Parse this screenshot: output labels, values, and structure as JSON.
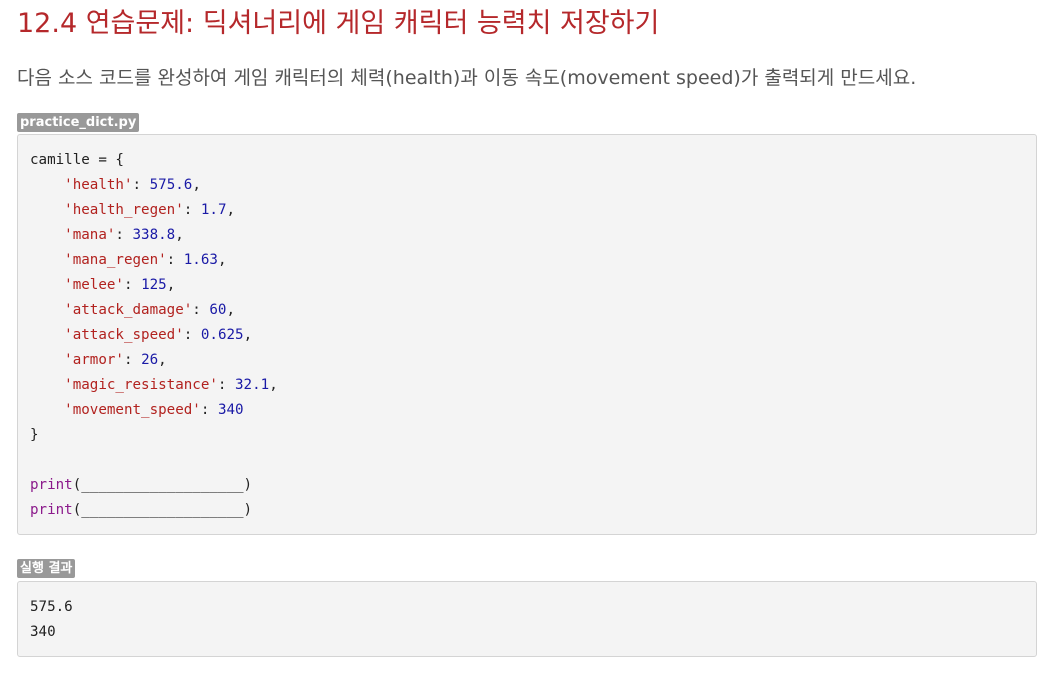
{
  "page": {
    "title": "12.4 연습문제: 딕셔너리에 게임 캐릭터 능력치 저장하기",
    "intro": "다음 소스 코드를 완성하여 게임 캐릭터의 체력(health)과 이동 속도(movement speed)가 출력되게 만드세요."
  },
  "source": {
    "filename": "practice_dict.py",
    "lines": [
      [
        {
          "t": "camille = {",
          "k": "plain"
        }
      ],
      [
        {
          "t": "    ",
          "k": "plain"
        },
        {
          "t": "'health'",
          "k": "str"
        },
        {
          "t": ": ",
          "k": "plain"
        },
        {
          "t": "575.6",
          "k": "num"
        },
        {
          "t": ",",
          "k": "plain"
        }
      ],
      [
        {
          "t": "    ",
          "k": "plain"
        },
        {
          "t": "'health_regen'",
          "k": "str"
        },
        {
          "t": ": ",
          "k": "plain"
        },
        {
          "t": "1.7",
          "k": "num"
        },
        {
          "t": ",",
          "k": "plain"
        }
      ],
      [
        {
          "t": "    ",
          "k": "plain"
        },
        {
          "t": "'mana'",
          "k": "str"
        },
        {
          "t": ": ",
          "k": "plain"
        },
        {
          "t": "338.8",
          "k": "num"
        },
        {
          "t": ",",
          "k": "plain"
        }
      ],
      [
        {
          "t": "    ",
          "k": "plain"
        },
        {
          "t": "'mana_regen'",
          "k": "str"
        },
        {
          "t": ": ",
          "k": "plain"
        },
        {
          "t": "1.63",
          "k": "num"
        },
        {
          "t": ",",
          "k": "plain"
        }
      ],
      [
        {
          "t": "    ",
          "k": "plain"
        },
        {
          "t": "'melee'",
          "k": "str"
        },
        {
          "t": ": ",
          "k": "plain"
        },
        {
          "t": "125",
          "k": "num"
        },
        {
          "t": ",",
          "k": "plain"
        }
      ],
      [
        {
          "t": "    ",
          "k": "plain"
        },
        {
          "t": "'attack_damage'",
          "k": "str"
        },
        {
          "t": ": ",
          "k": "plain"
        },
        {
          "t": "60",
          "k": "num"
        },
        {
          "t": ",",
          "k": "plain"
        }
      ],
      [
        {
          "t": "    ",
          "k": "plain"
        },
        {
          "t": "'attack_speed'",
          "k": "str"
        },
        {
          "t": ": ",
          "k": "plain"
        },
        {
          "t": "0.625",
          "k": "num"
        },
        {
          "t": ",",
          "k": "plain"
        }
      ],
      [
        {
          "t": "    ",
          "k": "plain"
        },
        {
          "t": "'armor'",
          "k": "str"
        },
        {
          "t": ": ",
          "k": "plain"
        },
        {
          "t": "26",
          "k": "num"
        },
        {
          "t": ",",
          "k": "plain"
        }
      ],
      [
        {
          "t": "    ",
          "k": "plain"
        },
        {
          "t": "'magic_resistance'",
          "k": "str"
        },
        {
          "t": ": ",
          "k": "plain"
        },
        {
          "t": "32.1",
          "k": "num"
        },
        {
          "t": ",",
          "k": "plain"
        }
      ],
      [
        {
          "t": "    ",
          "k": "plain"
        },
        {
          "t": "'movement_speed'",
          "k": "str"
        },
        {
          "t": ": ",
          "k": "plain"
        },
        {
          "t": "340",
          "k": "num"
        }
      ],
      [
        {
          "t": "}",
          "k": "plain"
        }
      ],
      [],
      [
        {
          "t": "print",
          "k": "fn"
        },
        {
          "t": "(___________________)",
          "k": "plain"
        }
      ],
      [
        {
          "t": "print",
          "k": "fn"
        },
        {
          "t": "(___________________)",
          "k": "plain"
        }
      ]
    ]
  },
  "result": {
    "label": "실행 결과",
    "lines": [
      "575.6",
      "340"
    ]
  },
  "colors": {
    "title": "#b5282b",
    "intro": "#555555",
    "badge_bg": "#999999",
    "code_bg": "#f4f4f4",
    "string": "#b2221f",
    "number": "#1a1aa6",
    "builtin": "#8b1a8b"
  }
}
